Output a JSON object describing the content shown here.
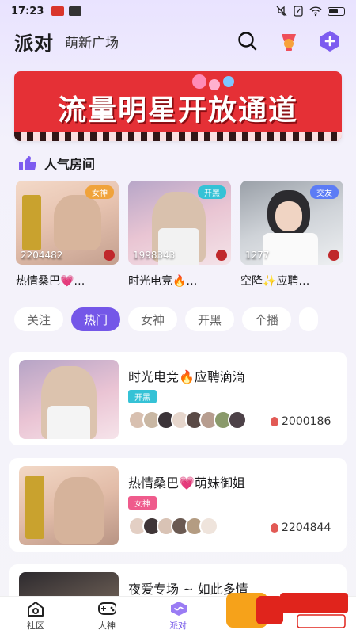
{
  "status_bar": {
    "time": "17:23"
  },
  "header": {
    "title": "派对",
    "subtitle": "萌新广场"
  },
  "banner": {
    "text": "流量明星开放通道"
  },
  "popular": {
    "title": "人气房间",
    "rooms": [
      {
        "tag": "女神",
        "count": "2204482",
        "name": "热情桑巴💗…"
      },
      {
        "tag": "开黑",
        "count": "1998343",
        "name": "时光电竞🔥…"
      },
      {
        "tag": "交友",
        "count": "1277",
        "name": "空降✨应聘…"
      }
    ]
  },
  "tabs": [
    "关注",
    "热门",
    "女神",
    "开黑",
    "个播"
  ],
  "active_tab": "热门",
  "feed": [
    {
      "name": "时光电竞🔥应聘滴滴",
      "tag": "开黑",
      "count": "2000186"
    },
    {
      "name": "热情桑巴💗萌妹御姐",
      "tag": "女神",
      "count": "2204844"
    },
    {
      "name": "夜爱专场 ~ 如此多情",
      "tag": "",
      "count": ""
    }
  ],
  "nav": [
    {
      "label": "社区",
      "icon": "home-icon"
    },
    {
      "label": "大神",
      "icon": "gamepad-icon"
    },
    {
      "label": "派对",
      "icon": "party-icon"
    }
  ],
  "colors": {
    "accent": "#7457e8",
    "banner_red": "#e53036",
    "tag_cyan": "#35c2d6",
    "tag_pink": "#ef5b8c",
    "tag_blue": "#5c7cf5"
  }
}
